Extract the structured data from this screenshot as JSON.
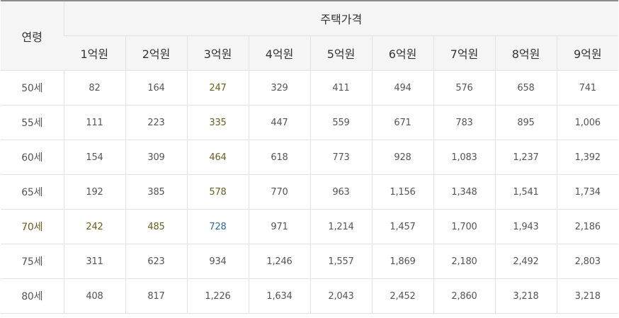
{
  "table": {
    "age_header": "연령",
    "price_header": "주택가격",
    "price_columns": [
      "1억원",
      "2억원",
      "3억원",
      "4억원",
      "5억원",
      "6억원",
      "7억원",
      "8억원",
      "9억원"
    ],
    "rows": [
      {
        "age": "50세",
        "values": [
          "82",
          "164",
          "247",
          "329",
          "411",
          "494",
          "576",
          "658",
          "741"
        ]
      },
      {
        "age": "55세",
        "values": [
          "111",
          "223",
          "335",
          "447",
          "559",
          "671",
          "783",
          "895",
          "1,006"
        ]
      },
      {
        "age": "60세",
        "values": [
          "154",
          "309",
          "464",
          "618",
          "773",
          "928",
          "1,083",
          "1,237",
          "1,392"
        ]
      },
      {
        "age": "65세",
        "values": [
          "192",
          "385",
          "578",
          "770",
          "963",
          "1,156",
          "1,348",
          "1,541",
          "1,734"
        ]
      },
      {
        "age": "70세",
        "values": [
          "242",
          "485",
          "728",
          "971",
          "1,214",
          "1,457",
          "1,700",
          "1,943",
          "2,186"
        ]
      },
      {
        "age": "75세",
        "values": [
          "311",
          "623",
          "934",
          "1,246",
          "1,557",
          "1,869",
          "2,180",
          "2,492",
          "2,803"
        ]
      },
      {
        "age": "80세",
        "values": [
          "408",
          "817",
          "1,226",
          "1,634",
          "2,043",
          "2,452",
          "2,860",
          "3,218",
          "3,218"
        ]
      }
    ],
    "highlight": {
      "row_age": "70세",
      "column": "3억원"
    },
    "colors": {
      "header_bg": "#f5f5f5",
      "border": "#e2e2e2",
      "top_border": "#8c8c8c",
      "highlight_text": "#6b5d1f",
      "cross_text": "#2d6a9c",
      "body_text": "#555555"
    }
  }
}
